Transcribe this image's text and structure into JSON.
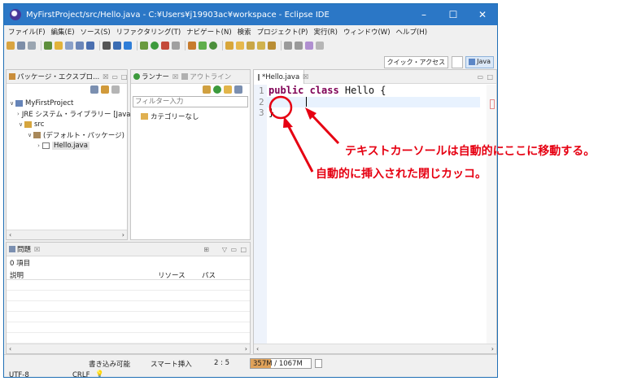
{
  "window": {
    "title": "MyFirstProject/src/Hello.java - C:¥Users¥j19903ac¥workspace - Eclipse IDE",
    "controls": [
      "–",
      "☐",
      "✕"
    ]
  },
  "menu": [
    "ファイル(F)",
    "編集(E)",
    "ソース(S)",
    "リファクタリング(T)",
    "ナビゲート(N)",
    "検索",
    "プロジェクト(P)",
    "実行(R)",
    "ウィンドウ(W)",
    "ヘルプ(H)"
  ],
  "quick_access": "クイック・アクセス",
  "perspective": "Java",
  "package_explorer": {
    "tab": "パッケージ・エクスプロ...",
    "tab_close": "☒",
    "tree": [
      {
        "label": "MyFirstProject",
        "twisty": "∨"
      },
      {
        "label": "JRE システム・ライブラリー [Java",
        "twisty": "›"
      },
      {
        "label": "src",
        "twisty": "∨"
      },
      {
        "label": "(デフォルト・パッケージ)",
        "twisty": "∨"
      },
      {
        "label": "Hello.java",
        "twisty": "›"
      }
    ]
  },
  "runner": {
    "tab1": "ランナー",
    "tab2": "アウトライン",
    "filter_placeholder": "フィルター入力",
    "category": "カテゴリーなし"
  },
  "editor": {
    "tab": "*Hello.java",
    "lines": [
      {
        "num": "1",
        "keyword": "public class",
        "text": " Hello {"
      },
      {
        "num": "2",
        "keyword": "",
        "text": ""
      },
      {
        "num": "3",
        "keyword": "",
        "text": "}"
      }
    ]
  },
  "problems": {
    "tab": "問題",
    "count": "0 項目",
    "columns": [
      "説明",
      "リソース",
      "パス"
    ]
  },
  "status": {
    "writable": "書き込み可能",
    "insert_mode": "スマート挿入",
    "position": "2 : 5",
    "heap": "357M / 1067M",
    "heap_used_fraction": 0.334,
    "encoding": "UTF-8",
    "line_delim": "CRLF"
  },
  "annotations": {
    "cursor_note": "テキストカーソールは自動的にここに移動する。",
    "brace_note": "自動的に挿入された閉じカッコ。",
    "color": "#e60012"
  }
}
